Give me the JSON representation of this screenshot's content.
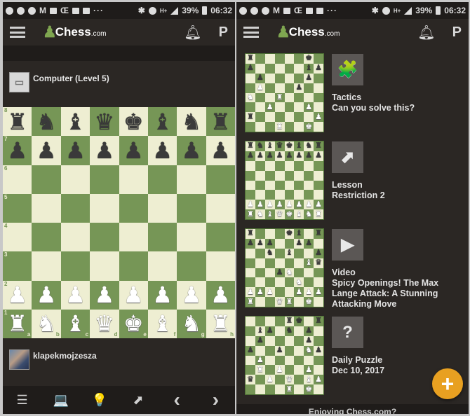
{
  "status_bar": {
    "battery": "39%",
    "time": "06:32",
    "network": "H+"
  },
  "app": {
    "logo_text": "Chess",
    "logo_suffix": ".com",
    "menu_icon": "hamburger-icon",
    "notifications_icon": "bell-icon",
    "profile_icon": "pawn-profile-icon"
  },
  "game": {
    "opponent": {
      "name": "Computer (Level 5)",
      "avatar_icon": "laptop-icon"
    },
    "player": {
      "name": "klapekmojzesza",
      "avatar": "user-photo"
    },
    "board_fen": "rnbqkbnr/pppppppp/8/8/8/8/PPPPPPPP/RNBQKBNR",
    "rank_labels": [
      "8",
      "7",
      "6",
      "5",
      "4",
      "3",
      "2",
      "1"
    ],
    "file_labels": [
      "a",
      "b",
      "c",
      "d",
      "e",
      "f",
      "g",
      "h"
    ],
    "toolbar": [
      {
        "icon": "move-list-icon",
        "glyph": "☰"
      },
      {
        "icon": "computer-icon",
        "glyph": "💻"
      },
      {
        "icon": "hint-lightbulb-icon",
        "glyph": "💡"
      },
      {
        "icon": "flip-board-icon",
        "glyph": "⬈"
      },
      {
        "icon": "previous-move-icon",
        "glyph": "‹"
      },
      {
        "icon": "next-move-icon",
        "glyph": "›"
      }
    ]
  },
  "feed": [
    {
      "type": "Tactics",
      "title": "Can you solve this?",
      "icon": "puzzle-icon",
      "glyph": "🧩",
      "fen": "r5k1/p5bp/1p4p1/1P3p2/N2R4/2P3P1/r6P/3R2K1"
    },
    {
      "type": "Lesson",
      "title": "Restriction 2",
      "icon": "lesson-arrow-icon",
      "glyph": "⬈",
      "fen": "rnbqkbnr/pppppppp/8/8/8/8/PPPPPPPP/RNBQKBNR"
    },
    {
      "type": "Video",
      "title": "Spicy Openings! The Max Lange Attack: A Stunning Attacking Move",
      "icon": "play-icon",
      "glyph": "▶",
      "fen": "r3kb1r/ppp2pp1/2n1b2p/6Bq/3pN3/5N2/PPP2PPP/R2QR1K1"
    },
    {
      "type": "Daily Puzzle",
      "title": "Dec 10, 2017",
      "icon": "question-icon",
      "glyph": "?",
      "fen": "4rk1r/1bp1n1p1/1p4p1/p2p2Np/1P6/1R1P2P1/q1P1Q1BP/4R1K1"
    }
  ],
  "fab": {
    "label": "+",
    "icon": "add-icon"
  },
  "footer_teaser": "Enjoying Chess.com?",
  "colors": {
    "light_square": "#eeeed2",
    "dark_square": "#769656",
    "accent": "#e8a021",
    "background": "#2b2724"
  }
}
